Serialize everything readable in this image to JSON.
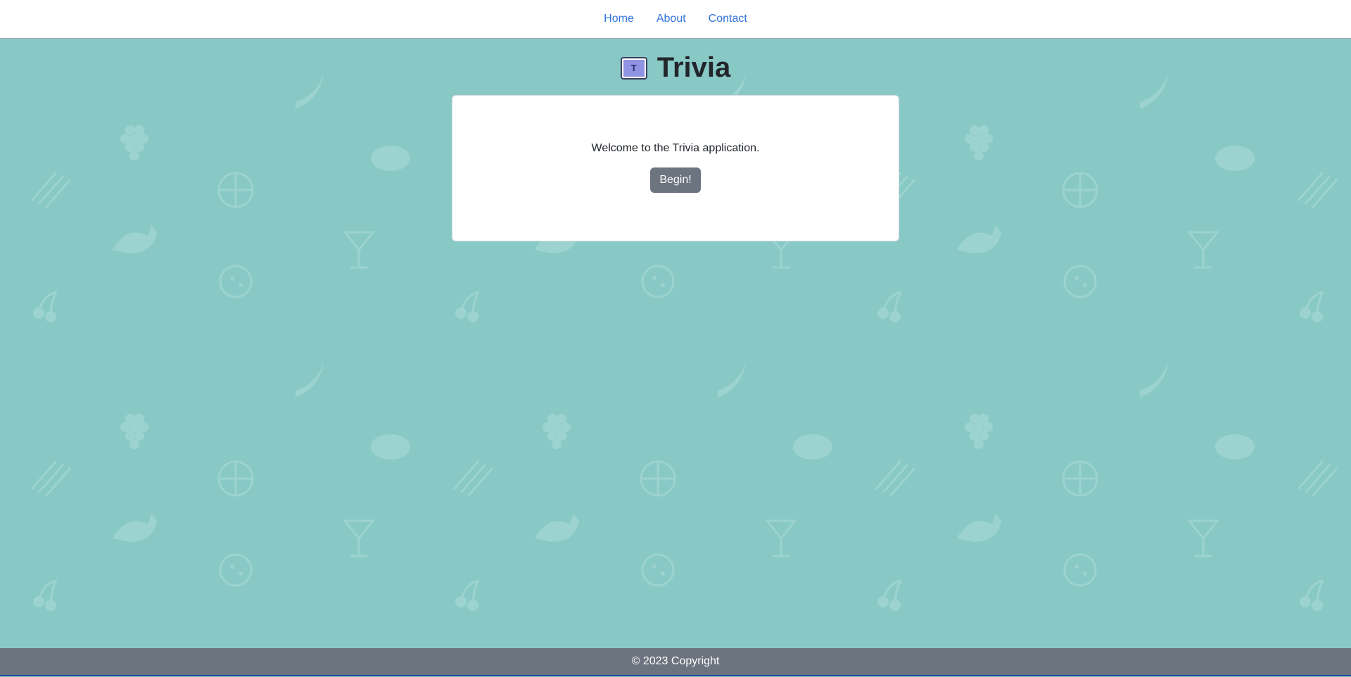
{
  "nav": {
    "items": [
      {
        "label": "Home"
      },
      {
        "label": "About"
      },
      {
        "label": "Contact"
      }
    ]
  },
  "header": {
    "logo_letter": "T",
    "title": "Trivia"
  },
  "card": {
    "welcome_text": "Welcome to the Trivia application.",
    "begin_label": "Begin!"
  },
  "footer": {
    "copyright": "© 2023 Copyright"
  },
  "colors": {
    "background": "#88c9c6",
    "link": "#2f73d9",
    "button": "#6c747f",
    "footer": "#6c747f",
    "logo": "#8f93e2"
  },
  "icons": [
    "food-pattern-background"
  ]
}
